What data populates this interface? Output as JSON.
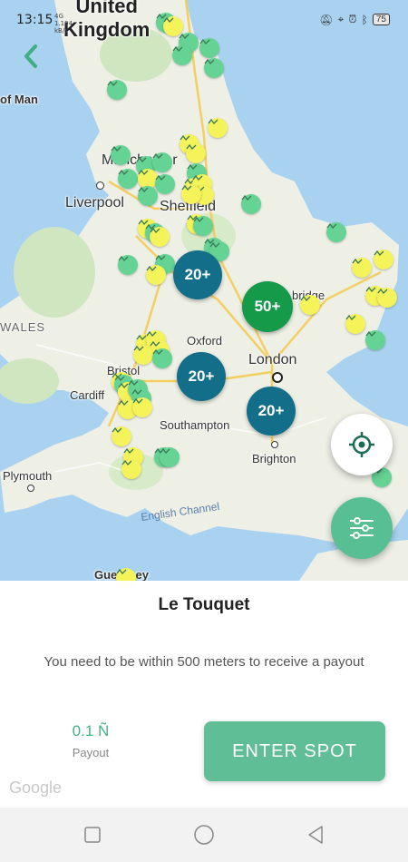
{
  "status_bar": {
    "time": "13:15",
    "network_line1": "4G",
    "network_line2": "1.194",
    "network_line3": "kB/s",
    "battery": "75"
  },
  "map": {
    "places": {
      "united_kingdom_l1": "United",
      "united_kingdom_l2": "Kingdom",
      "isle_of_man": "of Man",
      "manchester": "Manchester",
      "liverpool": "Liverpool",
      "sheffield": "Sheffield",
      "wales": "WALES",
      "oxford": "Oxford",
      "london": "London",
      "bristol": "Bristol",
      "cardiff": "Cardiff",
      "southampton": "Southampton",
      "brighton": "Brighton",
      "plymouth": "Plymouth",
      "cambridge": "bridge",
      "english_channel": "English Channel",
      "guernsey": "Guernsey"
    },
    "clusters": [
      "20+",
      "50+",
      "20+",
      "20+"
    ],
    "colors": {
      "sea": "#a9d2f0",
      "land": "#eef0e6",
      "green_spot": "#64d394",
      "yellow_spot": "#f4f35a",
      "cluster_blue": "#136e8a",
      "cluster_green": "#159a49",
      "accent": "#58bf93"
    }
  },
  "icons": {
    "back": "chevron-left-icon",
    "locate": "crosshair-icon",
    "filter": "sliders-icon"
  },
  "sheet": {
    "title": "Le Touquet",
    "message": "You need to be within 500 meters to receive a payout",
    "payout_value": "0.1 Ñ",
    "payout_label": "Payout",
    "enter_button": "ENTER SPOT",
    "google": "Google"
  }
}
